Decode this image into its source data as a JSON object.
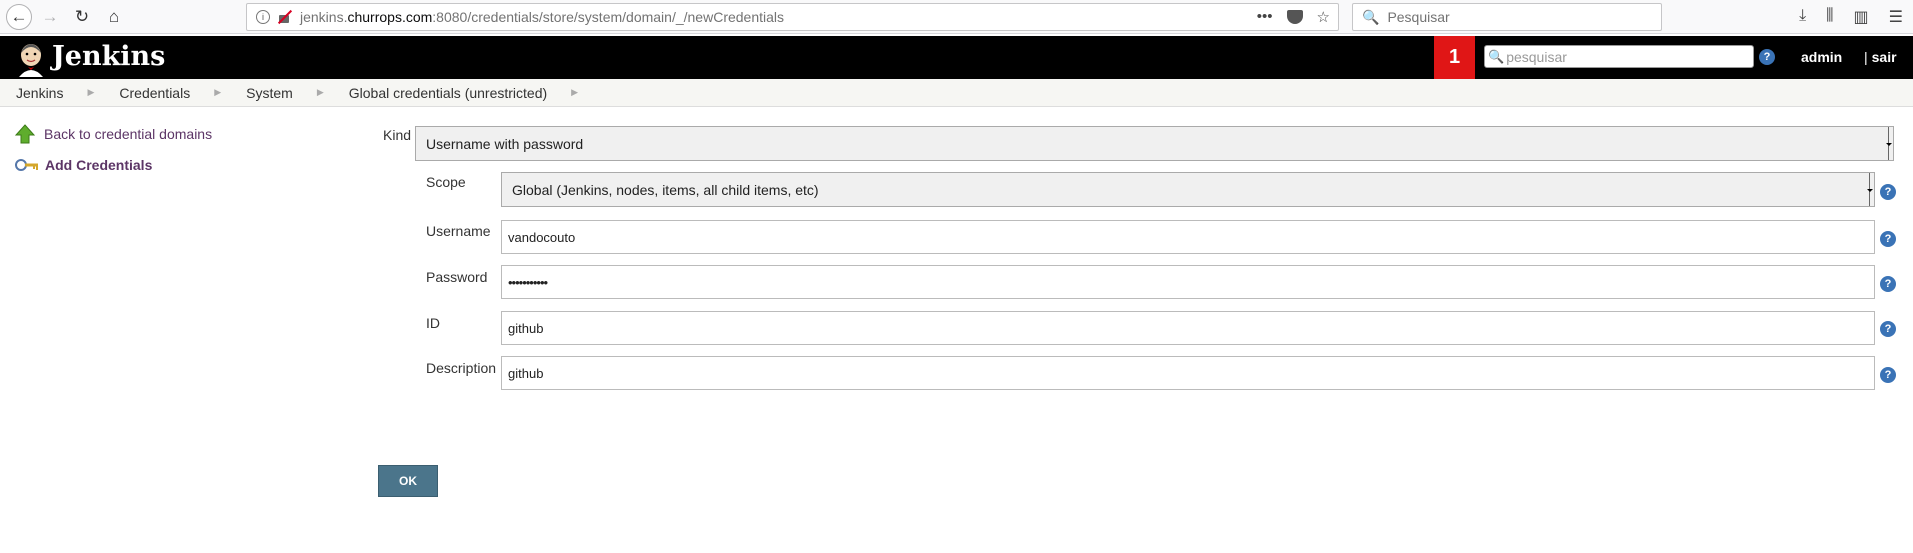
{
  "browser": {
    "url_prefix": "jenkins.",
    "url_domain": "churrops.com",
    "url_suffix": ":8080/credentials/store/system/domain/_/newCredentials",
    "search_placeholder": "Pesquisar"
  },
  "header": {
    "title": "Jenkins",
    "notification_count": "1",
    "search_placeholder": "pesquisar",
    "user": "admin",
    "logout_sep": "|",
    "logout": "sair"
  },
  "breadcrumb": [
    "Jenkins",
    "Credentials",
    "System",
    "Global credentials (unrestricted)"
  ],
  "sidebar": {
    "back_label": "Back to credential domains",
    "add_label": "Add Credentials"
  },
  "form": {
    "kind_label": "Kind",
    "kind_value": "Username with password",
    "scope_label": "Scope",
    "scope_value": "Global (Jenkins, nodes, items, all child items, etc)",
    "username_label": "Username",
    "username_value": "vandocouto",
    "password_label": "Password",
    "password_value": "•••••••••••",
    "id_label": "ID",
    "id_value": "github",
    "description_label": "Description",
    "description_value": "github",
    "ok_label": "OK"
  },
  "colors": {
    "header_bg": "#000000",
    "badge_bg": "#e01616",
    "link": "#5c3566",
    "ok_button": "#4b758b",
    "help_icon": "#3a73b6"
  }
}
